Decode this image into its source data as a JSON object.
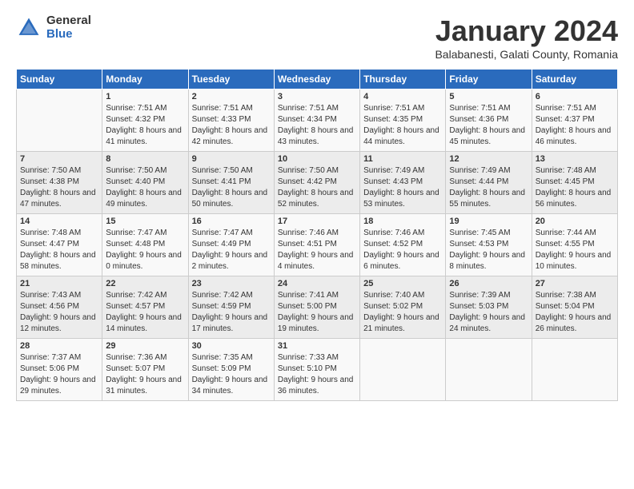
{
  "logo": {
    "general": "General",
    "blue": "Blue"
  },
  "title": "January 2024",
  "subtitle": "Balabanesti, Galati County, Romania",
  "days_of_week": [
    "Sunday",
    "Monday",
    "Tuesday",
    "Wednesday",
    "Thursday",
    "Friday",
    "Saturday"
  ],
  "weeks": [
    [
      {
        "day": "",
        "sunrise": "",
        "sunset": "",
        "daylight": ""
      },
      {
        "day": "1",
        "sunrise": "Sunrise: 7:51 AM",
        "sunset": "Sunset: 4:32 PM",
        "daylight": "Daylight: 8 hours and 41 minutes."
      },
      {
        "day": "2",
        "sunrise": "Sunrise: 7:51 AM",
        "sunset": "Sunset: 4:33 PM",
        "daylight": "Daylight: 8 hours and 42 minutes."
      },
      {
        "day": "3",
        "sunrise": "Sunrise: 7:51 AM",
        "sunset": "Sunset: 4:34 PM",
        "daylight": "Daylight: 8 hours and 43 minutes."
      },
      {
        "day": "4",
        "sunrise": "Sunrise: 7:51 AM",
        "sunset": "Sunset: 4:35 PM",
        "daylight": "Daylight: 8 hours and 44 minutes."
      },
      {
        "day": "5",
        "sunrise": "Sunrise: 7:51 AM",
        "sunset": "Sunset: 4:36 PM",
        "daylight": "Daylight: 8 hours and 45 minutes."
      },
      {
        "day": "6",
        "sunrise": "Sunrise: 7:51 AM",
        "sunset": "Sunset: 4:37 PM",
        "daylight": "Daylight: 8 hours and 46 minutes."
      }
    ],
    [
      {
        "day": "7",
        "sunrise": "Sunrise: 7:50 AM",
        "sunset": "Sunset: 4:38 PM",
        "daylight": "Daylight: 8 hours and 47 minutes."
      },
      {
        "day": "8",
        "sunrise": "Sunrise: 7:50 AM",
        "sunset": "Sunset: 4:40 PM",
        "daylight": "Daylight: 8 hours and 49 minutes."
      },
      {
        "day": "9",
        "sunrise": "Sunrise: 7:50 AM",
        "sunset": "Sunset: 4:41 PM",
        "daylight": "Daylight: 8 hours and 50 minutes."
      },
      {
        "day": "10",
        "sunrise": "Sunrise: 7:50 AM",
        "sunset": "Sunset: 4:42 PM",
        "daylight": "Daylight: 8 hours and 52 minutes."
      },
      {
        "day": "11",
        "sunrise": "Sunrise: 7:49 AM",
        "sunset": "Sunset: 4:43 PM",
        "daylight": "Daylight: 8 hours and 53 minutes."
      },
      {
        "day": "12",
        "sunrise": "Sunrise: 7:49 AM",
        "sunset": "Sunset: 4:44 PM",
        "daylight": "Daylight: 8 hours and 55 minutes."
      },
      {
        "day": "13",
        "sunrise": "Sunrise: 7:48 AM",
        "sunset": "Sunset: 4:45 PM",
        "daylight": "Daylight: 8 hours and 56 minutes."
      }
    ],
    [
      {
        "day": "14",
        "sunrise": "Sunrise: 7:48 AM",
        "sunset": "Sunset: 4:47 PM",
        "daylight": "Daylight: 8 hours and 58 minutes."
      },
      {
        "day": "15",
        "sunrise": "Sunrise: 7:47 AM",
        "sunset": "Sunset: 4:48 PM",
        "daylight": "Daylight: 9 hours and 0 minutes."
      },
      {
        "day": "16",
        "sunrise": "Sunrise: 7:47 AM",
        "sunset": "Sunset: 4:49 PM",
        "daylight": "Daylight: 9 hours and 2 minutes."
      },
      {
        "day": "17",
        "sunrise": "Sunrise: 7:46 AM",
        "sunset": "Sunset: 4:51 PM",
        "daylight": "Daylight: 9 hours and 4 minutes."
      },
      {
        "day": "18",
        "sunrise": "Sunrise: 7:46 AM",
        "sunset": "Sunset: 4:52 PM",
        "daylight": "Daylight: 9 hours and 6 minutes."
      },
      {
        "day": "19",
        "sunrise": "Sunrise: 7:45 AM",
        "sunset": "Sunset: 4:53 PM",
        "daylight": "Daylight: 9 hours and 8 minutes."
      },
      {
        "day": "20",
        "sunrise": "Sunrise: 7:44 AM",
        "sunset": "Sunset: 4:55 PM",
        "daylight": "Daylight: 9 hours and 10 minutes."
      }
    ],
    [
      {
        "day": "21",
        "sunrise": "Sunrise: 7:43 AM",
        "sunset": "Sunset: 4:56 PM",
        "daylight": "Daylight: 9 hours and 12 minutes."
      },
      {
        "day": "22",
        "sunrise": "Sunrise: 7:42 AM",
        "sunset": "Sunset: 4:57 PM",
        "daylight": "Daylight: 9 hours and 14 minutes."
      },
      {
        "day": "23",
        "sunrise": "Sunrise: 7:42 AM",
        "sunset": "Sunset: 4:59 PM",
        "daylight": "Daylight: 9 hours and 17 minutes."
      },
      {
        "day": "24",
        "sunrise": "Sunrise: 7:41 AM",
        "sunset": "Sunset: 5:00 PM",
        "daylight": "Daylight: 9 hours and 19 minutes."
      },
      {
        "day": "25",
        "sunrise": "Sunrise: 7:40 AM",
        "sunset": "Sunset: 5:02 PM",
        "daylight": "Daylight: 9 hours and 21 minutes."
      },
      {
        "day": "26",
        "sunrise": "Sunrise: 7:39 AM",
        "sunset": "Sunset: 5:03 PM",
        "daylight": "Daylight: 9 hours and 24 minutes."
      },
      {
        "day": "27",
        "sunrise": "Sunrise: 7:38 AM",
        "sunset": "Sunset: 5:04 PM",
        "daylight": "Daylight: 9 hours and 26 minutes."
      }
    ],
    [
      {
        "day": "28",
        "sunrise": "Sunrise: 7:37 AM",
        "sunset": "Sunset: 5:06 PM",
        "daylight": "Daylight: 9 hours and 29 minutes."
      },
      {
        "day": "29",
        "sunrise": "Sunrise: 7:36 AM",
        "sunset": "Sunset: 5:07 PM",
        "daylight": "Daylight: 9 hours and 31 minutes."
      },
      {
        "day": "30",
        "sunrise": "Sunrise: 7:35 AM",
        "sunset": "Sunset: 5:09 PM",
        "daylight": "Daylight: 9 hours and 34 minutes."
      },
      {
        "day": "31",
        "sunrise": "Sunrise: 7:33 AM",
        "sunset": "Sunset: 5:10 PM",
        "daylight": "Daylight: 9 hours and 36 minutes."
      },
      {
        "day": "",
        "sunrise": "",
        "sunset": "",
        "daylight": ""
      },
      {
        "day": "",
        "sunrise": "",
        "sunset": "",
        "daylight": ""
      },
      {
        "day": "",
        "sunrise": "",
        "sunset": "",
        "daylight": ""
      }
    ]
  ]
}
